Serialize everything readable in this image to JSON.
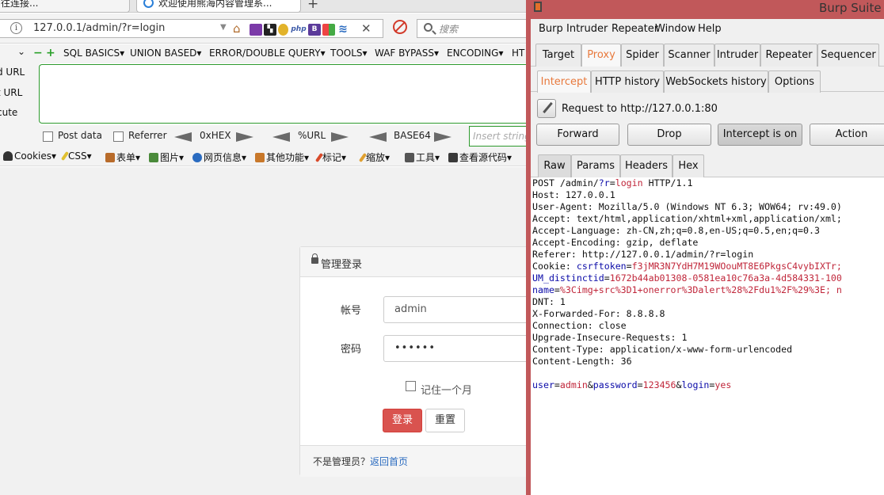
{
  "browser": {
    "tabs": [
      {
        "title": "往连接..."
      },
      {
        "title": "欢迎使用熊海内容管理系..."
      }
    ],
    "new_tab_glyph": "+",
    "url": "127.0.0.1/admin/?r=login",
    "search_placeholder": "搜索",
    "hackbar": {
      "menu": [
        "SQL BASICS▾",
        "UNION BASED▾",
        "ERROR/DOUBLE QUERY▾",
        "TOOLS▾",
        "WAF BYPASS▾",
        "ENCODING▾",
        "HT"
      ],
      "side": [
        "d URL",
        "t URL",
        "cute"
      ],
      "options": {
        "post_data": "Post data",
        "referrer": "Referrer",
        "hex": "0xHEX",
        "url": "%URL",
        "base64": "BASE64",
        "insert_placeholder": "Insert string"
      }
    },
    "toolbar": [
      "Cookies▾",
      "CSS▾",
      "表单▾",
      "图片▾",
      "网页信息▾",
      "其他功能▾",
      "标记▾",
      "缩放▾",
      "工具▾",
      "查看源代码▾"
    ],
    "login": {
      "title": "管理登录",
      "username_label": "帐号",
      "username_value": "admin",
      "password_label": "密码",
      "password_value": "••••••",
      "remember_label": "记住一个月",
      "login_button": "登录",
      "reset_button": "重置",
      "footer_text": "不是管理员？",
      "footer_link": "返回首页"
    }
  },
  "burp": {
    "title": "Burp Suite",
    "menu": [
      "Burp",
      "Intruder",
      "Repeater",
      "Window",
      "Help"
    ],
    "main_tabs": [
      "Target",
      "Proxy",
      "Spider",
      "Scanner",
      "Intruder",
      "Repeater",
      "Sequencer"
    ],
    "active_main_tab": "Proxy",
    "proxy_tabs": [
      "Intercept",
      "HTTP history",
      "WebSockets history",
      "Options"
    ],
    "active_proxy_tab": "Intercept",
    "request_label": "Request to http://127.0.0.1:80",
    "buttons": {
      "forward": "Forward",
      "drop": "Drop",
      "intercept": "Intercept is on",
      "action": "Action"
    },
    "view_tabs": [
      "Raw",
      "Params",
      "Headers",
      "Hex"
    ],
    "active_view_tab": "Raw",
    "request": {
      "line1_method": "POST /admin/",
      "line1_q": "?",
      "line1_param": "r",
      "line1_eq": "=",
      "line1_val": "login",
      "line1_ver": " HTTP/1.1",
      "host": "Host: 127.0.0.1",
      "user_agent": "User-Agent: Mozilla/5.0 (Windows NT 6.3; WOW64; rv:49.0)",
      "accept": "Accept: text/html,application/xhtml+xml,application/xml;",
      "accept_language": "Accept-Language: zh-CN,zh;q=0.8,en-US;q=0.5,en;q=0.3",
      "accept_encoding": "Accept-Encoding: gzip, deflate",
      "referer": "Referer: http://127.0.0.1/admin/?r=login",
      "cookie_head": "Cookie: ",
      "cookie_k1": "csrftoken",
      "cookie_v1": "f3jMR3N7YdH7M19WOouMT8E6PkgsC4vybIXTr;",
      "cookie_k2": "UM_distinctid",
      "cookie_v2": "1672b44ab01308-0581ea10c76a3a-4d584331-100",
      "cookie_k3": "name",
      "cookie_v3": "%3Cimg+src%3D1+onerror%3Dalert%28%2Fdu1%2F%29%3E; n",
      "dnt": "DNT: 1",
      "xff": "X-Forwarded-For: 8.8.8.8",
      "connection": "Connection: close",
      "upgrade": "Upgrade-Insecure-Requests: 1",
      "content_type": "Content-Type: application/x-www-form-urlencoded",
      "content_length": "Content-Length: 36",
      "body_k1": "user",
      "body_v1": "admin",
      "body_k2": "password",
      "body_v2": "123456",
      "body_k3": "login",
      "body_v3": "yes"
    }
  },
  "colors": {
    "burp_accent": "#e8793c",
    "burp_frame": "#c1585a",
    "login_button": "#d9534f",
    "hackbar_border": "#2d9a2d"
  }
}
